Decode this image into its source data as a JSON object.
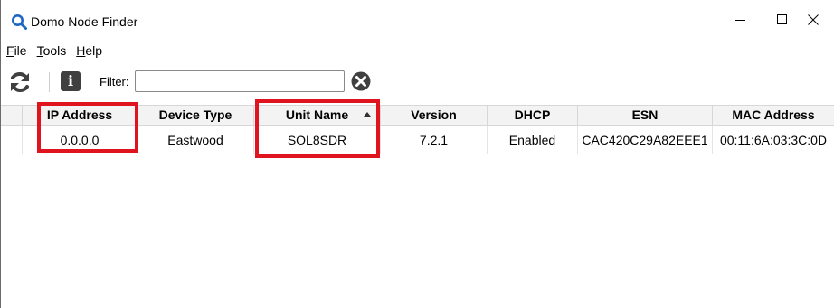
{
  "window": {
    "title": "Domo Node Finder",
    "icon": "magnifier-icon",
    "controls": [
      "minimize-icon",
      "maximize-icon",
      "close-icon"
    ]
  },
  "menu": {
    "items": [
      {
        "mnemonic": "F",
        "rest": "ile"
      },
      {
        "mnemonic": "T",
        "rest": "ools"
      },
      {
        "mnemonic": "H",
        "rest": "elp"
      }
    ]
  },
  "toolbar": {
    "refresh_icon": "refresh-icon",
    "info_icon": "info-icon",
    "info_glyph": "i",
    "filter_label": "Filter:",
    "filter_value": "",
    "clear_icon": "clear-filter-icon"
  },
  "table": {
    "columns": [
      "IP Address",
      "Device Type",
      "Unit Name",
      "Version",
      "DHCP",
      "ESN",
      "MAC Address"
    ],
    "sorted_column": "Unit Name",
    "sort_direction": "ascending",
    "rows": [
      {
        "ip": "0.0.0.0",
        "device_type": "Eastwood",
        "unit_name": "SOL8SDR",
        "version": "7.2.1",
        "dhcp": "Enabled",
        "esn": "CAC420C29A82EEE1",
        "mac": "00:11:6A:03:3C:0D"
      }
    ]
  },
  "colors": {
    "highlight": "#e0141e",
    "icon_blue": "#1f66c4",
    "icon_dark": "#404040"
  }
}
